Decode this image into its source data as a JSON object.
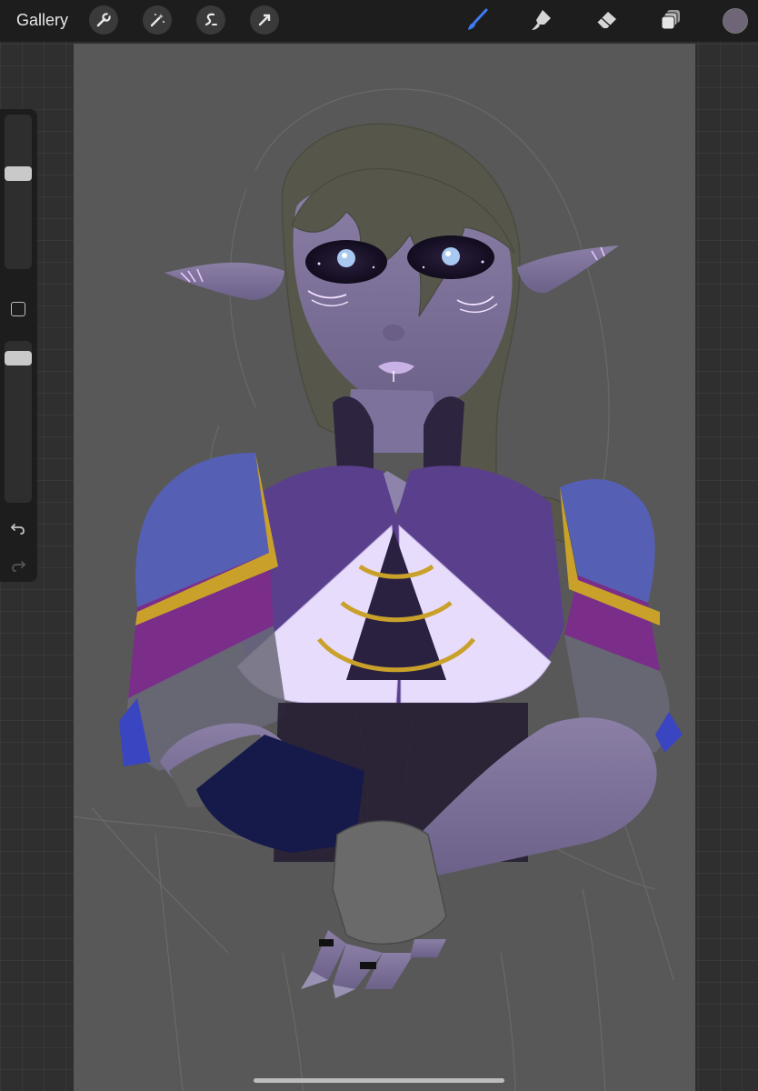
{
  "toolbar": {
    "gallery_label": "Gallery",
    "left_tools": [
      "wrench-icon",
      "magic-wand-icon",
      "selection-icon",
      "transform-arrow-icon"
    ],
    "right_tools": [
      "brush-icon",
      "smudge-icon",
      "eraser-icon",
      "layers-icon"
    ],
    "active_tool": "brush",
    "active_color": "#6e6577",
    "accent_color": "#3d7cf5"
  },
  "sidebar": {
    "brush_size": 0.63,
    "opacity": 0.93
  },
  "canvas": {
    "background": "#585858"
  }
}
